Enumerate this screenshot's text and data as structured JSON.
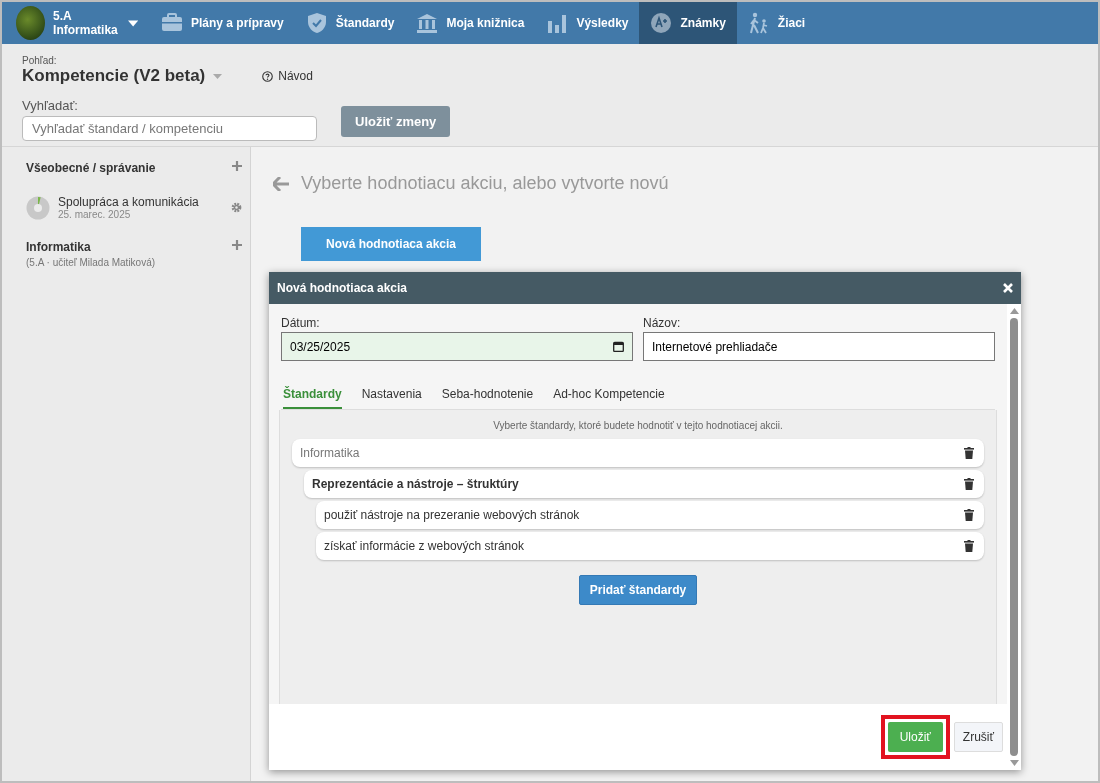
{
  "nav": {
    "class_name": "5.A",
    "subject": "Informatika",
    "items": [
      {
        "label": "Plány a prípravy",
        "kind": "plans",
        "selected": false
      },
      {
        "label": "Štandardy",
        "kind": "standards",
        "selected": false
      },
      {
        "label": "Moja knižnica",
        "kind": "library",
        "selected": false
      },
      {
        "label": "Výsledky",
        "kind": "results",
        "selected": false
      },
      {
        "label": "Známky",
        "kind": "grades",
        "selected": true
      },
      {
        "label": "Žiaci",
        "kind": "students",
        "selected": false
      }
    ]
  },
  "header": {
    "view_label": "Pohľad:",
    "view": "Kompetencie (V2 beta)",
    "help": "Návod",
    "search_label": "Vyhľadať:",
    "search_placeholder": "Vyhľadať štandard / kompetenciu",
    "save_button": "Uložiť zmeny"
  },
  "sidebar": {
    "items": [
      {
        "kind": "group",
        "title": "Všeobecné / správanie"
      },
      {
        "kind": "action",
        "title": "Spolupráca a komunikácia",
        "date": "25. marec. 2025"
      },
      {
        "kind": "group",
        "title": "Informatika",
        "subtitle": "(5.A · učiteľ Milada Matiková)"
      }
    ]
  },
  "main": {
    "title": "Vyberte hodnotiacu akciu, alebo vytvorte novú",
    "new_button": "Nová hodnotiaca akcia"
  },
  "dialog": {
    "title": "Nová hodnotiaca akcia",
    "date_label": "Dátum:",
    "date_value": "03/25/2025",
    "name_label": "Názov:",
    "name_value": "Internetové prehliadače",
    "tabs": [
      {
        "label": "Štandardy",
        "selected": true
      },
      {
        "label": "Nastavenia",
        "selected": false
      },
      {
        "label": "Seba-hodnotenie",
        "selected": false
      },
      {
        "label": "Ad-hoc Kompetencie",
        "selected": false
      }
    ],
    "hint": "Vyberte štandardy, ktoré budete hodnotiť v tejto hodnotiacej akcii.",
    "standards": [
      {
        "label": "Informatika",
        "children": [
          {
            "label": "Reprezentácie a nástroje – štruktúry",
            "children": [
              {
                "label": "použiť nástroje na prezeranie webových stránok"
              },
              {
                "label": "získať informácie z webových stránok"
              }
            ]
          }
        ]
      }
    ],
    "add_button": "Pridať štandardy",
    "save_button": "Uložiť",
    "save_highlighted": true,
    "cancel_button": "Zrušiť"
  }
}
